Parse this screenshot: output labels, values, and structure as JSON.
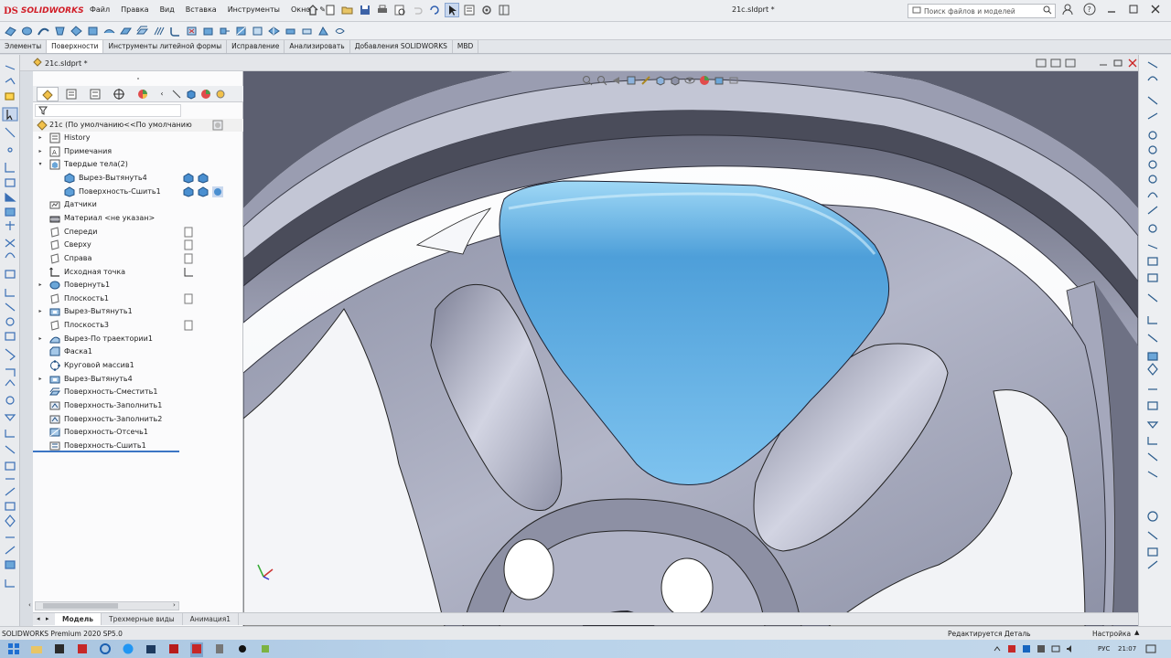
{
  "app": {
    "brand_ds": "DS",
    "brand_name": "SOLIDWORKS",
    "menus": [
      "Файл",
      "Правка",
      "Вид",
      "Вставка",
      "Инструменты",
      "Окно"
    ],
    "document_title": "21c.sldprt *",
    "search_placeholder": "Поиск файлов и моделей"
  },
  "ribbon_tabs": [
    {
      "label": "Элементы",
      "active": false
    },
    {
      "label": "Поверхности",
      "active": true
    },
    {
      "label": "Инструменты литейной формы",
      "active": false
    },
    {
      "label": "Исправление",
      "active": false
    },
    {
      "label": "Анализировать",
      "active": false
    },
    {
      "label": "Добавления SOLIDWORKS",
      "active": false
    },
    {
      "label": "MBD",
      "active": false
    }
  ],
  "document_tab": "21c.sldprt *",
  "feature_tree": {
    "root": "21c (По умолчанию<<По умолчанию",
    "nodes": [
      {
        "label": "History",
        "icon": "history-icon",
        "expand": "▸",
        "level": 0
      },
      {
        "label": "Примечания",
        "icon": "annotations-icon",
        "expand": "▸",
        "level": 0
      },
      {
        "label": "Твердые тела(2)",
        "icon": "solid-bodies-icon",
        "expand": "▾",
        "level": 0
      },
      {
        "label": "Вырез-Вытянуть4",
        "icon": "solid-body-icon",
        "expand": "",
        "level": 1
      },
      {
        "label": "Поверхность-Сшить1",
        "icon": "solid-body-icon",
        "expand": "",
        "level": 1
      },
      {
        "label": "Датчики",
        "icon": "sensor-icon",
        "expand": "",
        "level": 0
      },
      {
        "label": "Материал <не указан>",
        "icon": "material-icon",
        "expand": "",
        "level": 0
      },
      {
        "label": "Спереди",
        "icon": "plane-icon",
        "expand": "",
        "level": 0
      },
      {
        "label": "Сверху",
        "icon": "plane-icon",
        "expand": "",
        "level": 0
      },
      {
        "label": "Справа",
        "icon": "plane-icon",
        "expand": "",
        "level": 0
      },
      {
        "label": "Исходная точка",
        "icon": "origin-icon",
        "expand": "",
        "level": 0
      },
      {
        "label": "Повернуть1",
        "icon": "revolve-icon",
        "expand": "▸",
        "level": 0
      },
      {
        "label": "Плоскость1",
        "icon": "plane-icon",
        "expand": "",
        "level": 0
      },
      {
        "label": "Вырез-Вытянуть1",
        "icon": "cut-extrude-icon",
        "expand": "▸",
        "level": 0
      },
      {
        "label": "Плоскость3",
        "icon": "plane-icon",
        "expand": "",
        "level": 0
      },
      {
        "label": "Вырез-По траектории1",
        "icon": "cut-sweep-icon",
        "expand": "▸",
        "level": 0
      },
      {
        "label": "Фаска1",
        "icon": "chamfer-icon",
        "expand": "",
        "level": 0
      },
      {
        "label": "Круговой массив1",
        "icon": "circular-pattern-icon",
        "expand": "",
        "level": 0
      },
      {
        "label": "Вырез-Вытянуть4",
        "icon": "cut-extrude-icon",
        "expand": "▸",
        "level": 0
      },
      {
        "label": "Поверхность-Сместить1",
        "icon": "offset-surface-icon",
        "expand": "",
        "level": 0
      },
      {
        "label": "Поверхность-Заполнить1",
        "icon": "fill-surface-icon",
        "expand": "",
        "level": 0
      },
      {
        "label": "Поверхность-Заполнить2",
        "icon": "fill-surface-icon",
        "expand": "",
        "level": 0
      },
      {
        "label": "Поверхность-Отсечь1",
        "icon": "trim-surface-icon",
        "expand": "",
        "level": 0
      },
      {
        "label": "Поверхность-Сшить1",
        "icon": "knit-surface-icon",
        "expand": "",
        "level": 0
      }
    ]
  },
  "bottom_tabs": [
    {
      "label": "Модель",
      "active": true
    },
    {
      "label": "Трехмерные виды",
      "active": false
    },
    {
      "label": "Анимация1",
      "active": false
    }
  ],
  "status": {
    "version": "SOLIDWORKS Premium 2020 SP5.0",
    "mode": "Редактируется Деталь",
    "settings": "Настройка"
  },
  "taskbar": {
    "lang": "РУС",
    "time": "21:07"
  },
  "colors": {
    "accent": "#3b75c4",
    "selected_surface": "#62b4e8",
    "metal": "#a4a8bd",
    "brand_red": "#d11d27"
  }
}
